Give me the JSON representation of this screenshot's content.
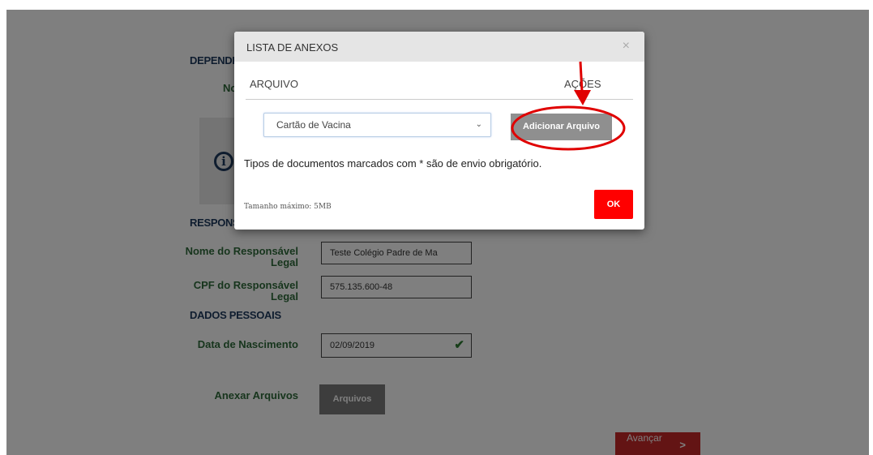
{
  "background": {
    "section_dependente_partial": "DEPENDE",
    "label_no_partial": "No",
    "section_responsavel_partial": "RESPONS",
    "responsavel_nome_label": "Nome do Responsável Legal",
    "responsavel_nome_value": "Teste Colégio Padre de Ma",
    "responsavel_cpf_label": "CPF do Responsável Legal",
    "responsavel_cpf_value": "575.135.600-48",
    "section_dados_pessoais": "DADOS PESSOAIS",
    "data_nascimento_label": "Data de Nascimento",
    "data_nascimento_value": "02/09/2019",
    "anexar_label": "Anexar Arquivos",
    "arquivos_button": "Arquivos",
    "avancar_button": "Avançar",
    "info_icon_glyph": "i"
  },
  "modal": {
    "title": "LISTA DE ANEXOS",
    "close_glyph": "×",
    "col_arquivo": "ARQUIVO",
    "col_acoes": "AÇÕES",
    "select_value": "Cartão de Vacina",
    "add_button": "Adicionar Arquivo",
    "notice": "Tipos de documentos marcados com * são de envio obrigatório.",
    "size_note": "Tamanho máximo: 5MB",
    "ok_button": "OK"
  },
  "icons": {
    "info": "info-circle-icon",
    "check": "checkmark-icon",
    "chevron": "chevron-right-icon",
    "caret": "chevron-down-icon"
  },
  "colors": {
    "ok_red": "#ff0000",
    "avancar_red": "#c62828",
    "annotation_red": "#e00000",
    "label_green": "#2e6b3a",
    "title_navy": "#1e3a5f"
  }
}
